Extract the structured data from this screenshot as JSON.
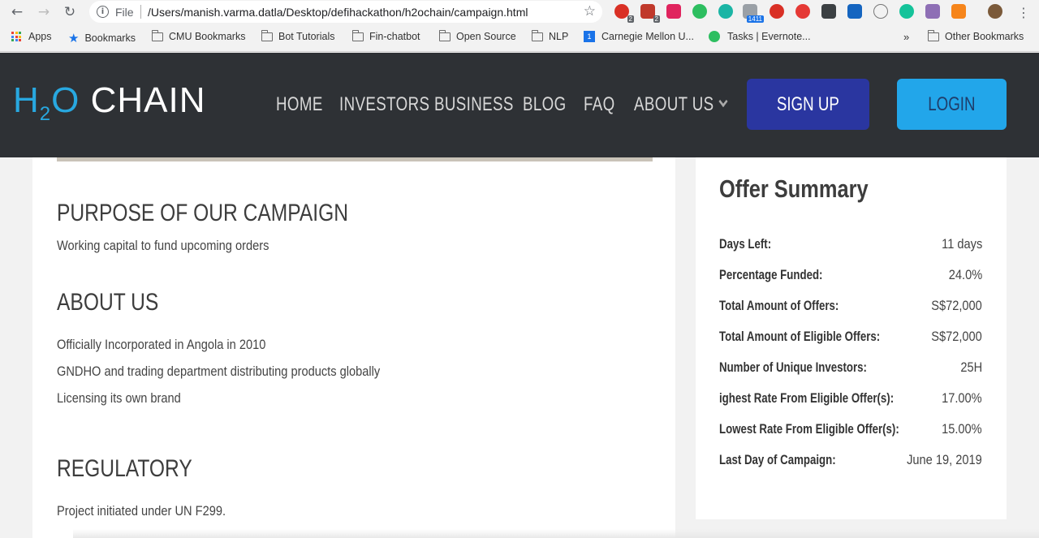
{
  "browser": {
    "file_label": "File",
    "url": "/Users/manish.varma.datla/Desktop/defihackathon/h2ochain/campaign.html",
    "ext_badges": [
      "2",
      "2",
      "1411"
    ]
  },
  "bookmarks": {
    "apps": "Apps",
    "items": [
      "Bookmarks",
      "CMU Bookmarks",
      "Bot Tutorials",
      "Fin-chatbot",
      "Open Source",
      "NLP",
      "Carnegie Mellon U...",
      "Tasks | Evernote..."
    ],
    "overflow": "»",
    "other": "Other Bookmarks"
  },
  "site": {
    "logo_h": "H",
    "logo_sub": "2",
    "logo_o": "O",
    "logo_rest": " CHAIN",
    "nav": [
      "HOME",
      "INVESTORS",
      "BUSINESS",
      "BLOG",
      "FAQ",
      "ABOUT US"
    ],
    "signup": "SIGN UP",
    "login": "LOGIN"
  },
  "main": {
    "purpose_title": "PURPOSE OF OUR CAMPAIGN",
    "purpose_text": "Working capital to fund upcoming orders",
    "about_title": "ABOUT US",
    "about_lines": [
      "Officially Incorporated in Angola in 2010",
      "GNDHO and trading department distributing products globally",
      "Licensing its own brand"
    ],
    "regulatory_title": "REGULATORY",
    "regulatory_text": "Project initiated under UN F299."
  },
  "offer": {
    "title": "Offer Summary",
    "rows": [
      {
        "label": "Days Left:",
        "value": "11 days"
      },
      {
        "label": "Percentage Funded:",
        "value": "24.0%"
      },
      {
        "label": "Total Amount of Offers:",
        "value": "S$72,000"
      },
      {
        "label": "Total Amount of Eligible Offers:",
        "value": "S$72,000"
      },
      {
        "label": "Number of Unique Investors:",
        "value": "25H"
      },
      {
        "label": "ighest Rate From Eligible Offer(s):",
        "value": "17.00%"
      },
      {
        "label": "Lowest Rate From Eligible Offer(s):",
        "value": "15.00%"
      },
      {
        "label": "Last Day of Campaign:",
        "value": "June 19, 2019"
      }
    ]
  }
}
